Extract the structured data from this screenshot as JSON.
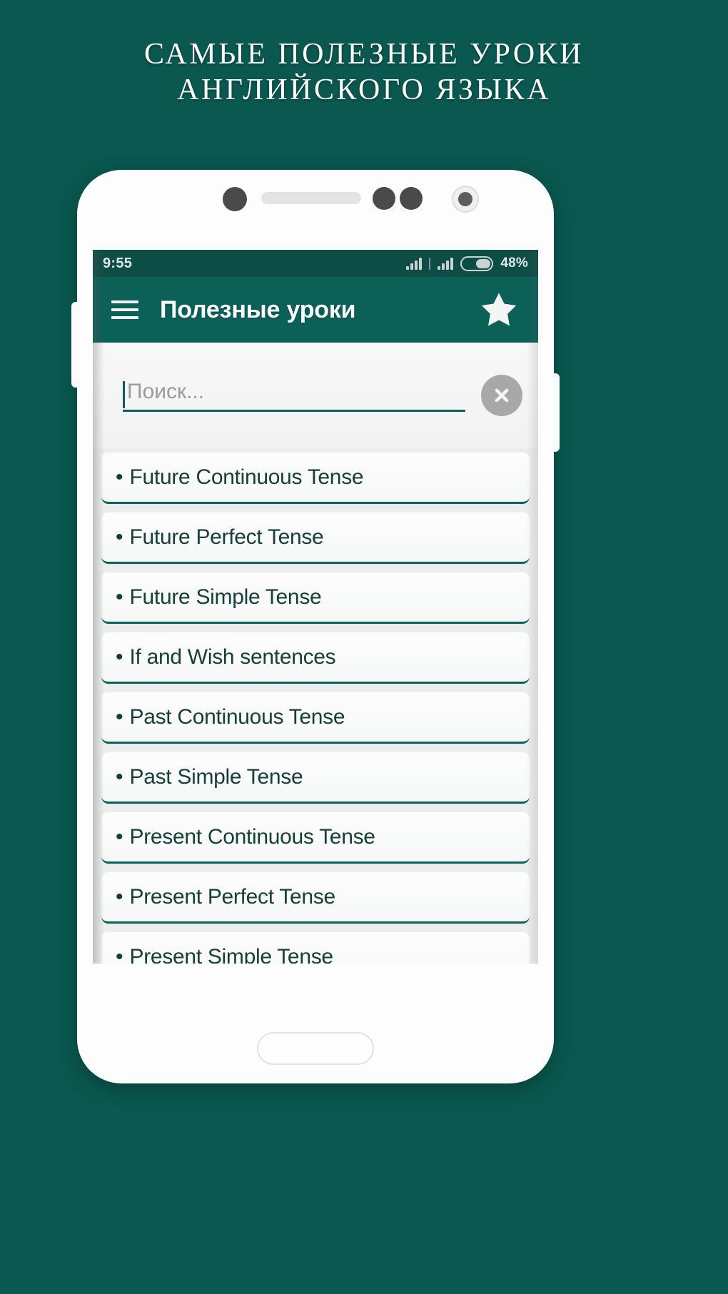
{
  "promo": {
    "headline_line1": "САМЫЕ ПОЛЕЗНЫЕ УРОКИ",
    "headline_line2": "АНГЛИЙСКОГО ЯЗЫКА"
  },
  "colors": {
    "background": "#0a584f",
    "app_bar": "#0b6057",
    "status_bar": "#0e4d45",
    "accent": "#0b6057",
    "list_text": "#173f39"
  },
  "status_bar": {
    "clock": "9:55",
    "battery_percent": "48%",
    "signal_icon_1": "signal-bars-icon",
    "signal_icon_2": "signal-bars-icon",
    "battery_icon": "battery-icon"
  },
  "app_bar": {
    "menu_icon": "hamburger-menu-icon",
    "title": "Полезные уроки",
    "favorite_icon": "star-icon"
  },
  "search": {
    "value": "",
    "placeholder": "Поиск...",
    "clear_icon": "close-circle-icon"
  },
  "list": {
    "bullet": "•",
    "items": [
      {
        "label": "Future Continuous Tense"
      },
      {
        "label": "Future Perfect Tense"
      },
      {
        "label": "Future Simple Tense"
      },
      {
        "label": "If and Wish sentences"
      },
      {
        "label": "Past Continuous Tense"
      },
      {
        "label": "Past Simple Tense"
      },
      {
        "label": "Present Continuous Tense"
      },
      {
        "label": "Present Perfect Tense"
      },
      {
        "label": "Present Simple Tense"
      }
    ]
  },
  "device": {
    "speaker_icon": "speaker-grille-icon",
    "camera_icon": "front-camera-icon",
    "sensor_icon": "proximity-sensor-icon",
    "home_button_icon": "home-button-icon"
  }
}
